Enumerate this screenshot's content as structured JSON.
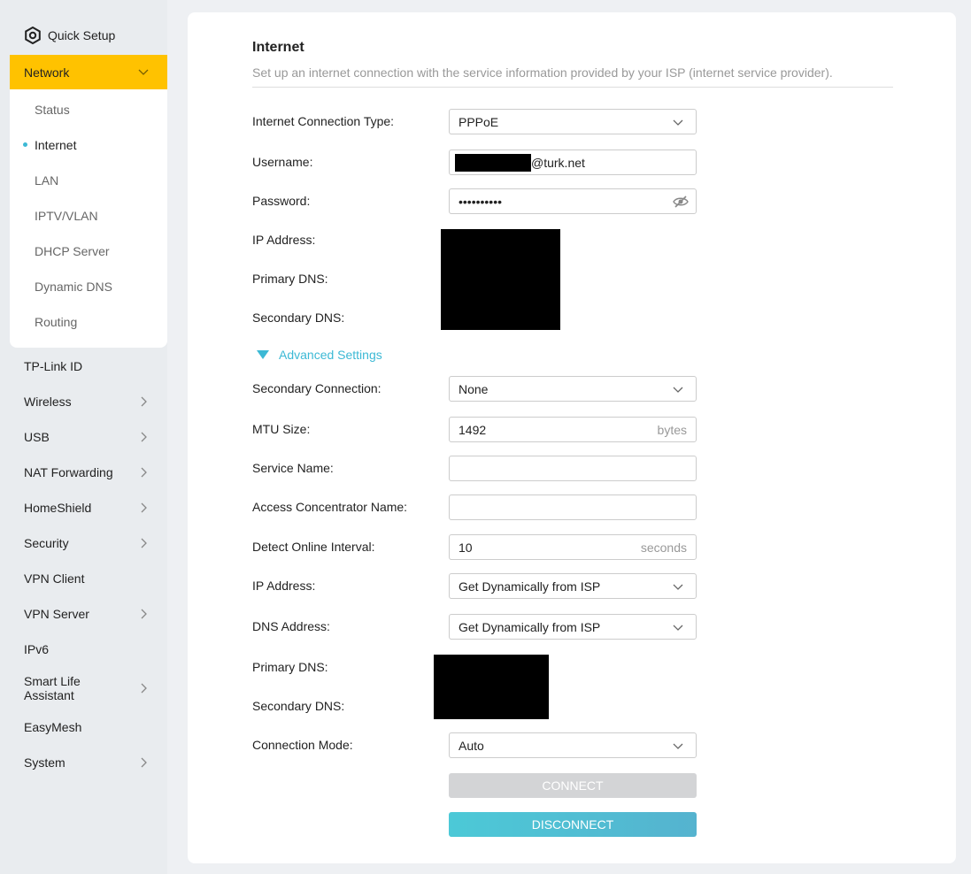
{
  "sidebar": {
    "quick_setup": "Quick Setup",
    "network": "Network",
    "network_sub": [
      "Status",
      "Internet",
      "LAN",
      "IPTV/VLAN",
      "DHCP Server",
      "Dynamic DNS",
      "Routing"
    ],
    "items": [
      "TP-Link ID",
      "Wireless",
      "USB",
      "NAT Forwarding",
      "HomeShield",
      "Security",
      "VPN Client",
      "VPN Server",
      "IPv6",
      "Smart Life Assistant",
      "EasyMesh",
      "System"
    ]
  },
  "main": {
    "title": "Internet",
    "subtitle": "Set up an internet connection with the service information provided by your ISP (internet service provider).",
    "labels": {
      "connection_type": "Internet Connection Type:",
      "username": "Username:",
      "password": "Password:",
      "ip_address": "IP Address:",
      "primary_dns": "Primary DNS:",
      "secondary_dns": "Secondary DNS:",
      "secondary_connection": "Secondary Connection:",
      "mtu": "MTU Size:",
      "service_name": "Service Name:",
      "ac_name": "Access Concentrator Name:",
      "detect_interval": "Detect Online Interval:",
      "ip_address2": "IP Address:",
      "dns_address": "DNS Address:",
      "primary_dns2": "Primary DNS:",
      "secondary_dns2": "Secondary DNS:",
      "connection_mode": "Connection Mode:"
    },
    "values": {
      "connection_type": "PPPoE",
      "username_suffix": "@turk.net",
      "password": "••••••••••",
      "secondary_connection": "None",
      "mtu": "1492",
      "mtu_unit": "bytes",
      "service_name": "",
      "ac_name": "",
      "detect_interval": "10",
      "detect_unit": "seconds",
      "ip_address": "Get Dynamically from ISP",
      "dns_address": "Get Dynamically from ISP",
      "connection_mode": "Auto"
    },
    "advanced": "Advanced Settings",
    "connect": "CONNECT",
    "disconnect": "DISCONNECT"
  },
  "colors": {
    "accent": "#3cb9d5",
    "network_highlight": "#ffc200",
    "disabled": "#d3d4d6"
  }
}
